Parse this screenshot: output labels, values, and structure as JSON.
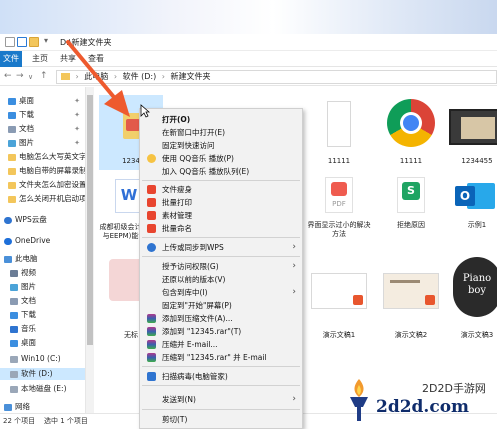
{
  "window": {
    "title_path": "D:\\新建文件夹"
  },
  "ribbon": {
    "tabs": [
      "文件",
      "主页",
      "共享",
      "查看"
    ]
  },
  "address": {
    "crumbs": [
      "此电脑",
      "软件 (D:)",
      "新建文件夹"
    ]
  },
  "sidebar": {
    "items": [
      {
        "label": "桌面",
        "pinned": true
      },
      {
        "label": "下载",
        "pinned": true
      },
      {
        "label": "文档",
        "pinned": true
      },
      {
        "label": "图片",
        "pinned": true
      },
      {
        "label": "电脑怎么大写英文字"
      },
      {
        "label": "电脑自带的屏幕录制"
      },
      {
        "label": "文件夹怎么加密设置"
      },
      {
        "label": "怎么关闭开机启动项"
      },
      {
        "label": "WPS云盘"
      },
      {
        "label": "OneDrive"
      },
      {
        "label": "此电脑"
      },
      {
        "label": "视频"
      },
      {
        "label": "图片"
      },
      {
        "label": "文档"
      },
      {
        "label": "下载"
      },
      {
        "label": "音乐"
      },
      {
        "label": "桌面"
      },
      {
        "label": "Win10 (C:)"
      },
      {
        "label": "软件 (D:)"
      },
      {
        "label": "本地磁盘 (E:)"
      },
      {
        "label": "网络"
      }
    ]
  },
  "files": [
    {
      "label": "1234"
    },
    {
      "label": "11111"
    },
    {
      "label": "11111"
    },
    {
      "label": "1234455"
    },
    {
      "label": "成都初级会计行业写与EEPM)能够感证"
    },
    {
      "label": "界面显示过小的解决方法"
    },
    {
      "label": "拒绝原因"
    },
    {
      "label": "示例1"
    },
    {
      "label": "无标"
    },
    {
      "label": "演示文稿1"
    },
    {
      "label": "演示文稿2"
    },
    {
      "label": "演示文稿3"
    }
  ],
  "status": {
    "count": "22 个项目",
    "selected": "选中 1 个项目"
  },
  "context_menu": {
    "items": [
      {
        "label": "打开(O)",
        "bold": true
      },
      {
        "label": "在新窗口中打开(E)"
      },
      {
        "label": "固定到快速访问"
      },
      {
        "label": "使用 QQ音乐 播放(P)"
      },
      {
        "label": "加入 QQ音乐 播放队列(E)"
      },
      {
        "label": "文件瘦身"
      },
      {
        "label": "批量打印"
      },
      {
        "label": "素材管理"
      },
      {
        "label": "批量命名"
      },
      {
        "label": "上传或同步到WPS",
        "submenu": true
      },
      {
        "label": "授予访问权限(G)",
        "submenu": true
      },
      {
        "label": "还原以前的版本(V)"
      },
      {
        "label": "包含到库中(I)",
        "submenu": true
      },
      {
        "label": "固定到\"开始\"屏幕(P)"
      },
      {
        "label": "添加到压缩文件(A)..."
      },
      {
        "label": "添加到 \"12345.rar\"(T)"
      },
      {
        "label": "压缩并 E-mail..."
      },
      {
        "label": "压缩到 \"12345.rar\" 并 E-mail"
      },
      {
        "label": "扫描病毒(电脑管家)"
      },
      {
        "label": "发送到(N)",
        "submenu": true
      },
      {
        "label": "剪切(T)"
      }
    ]
  },
  "watermark": {
    "brand": "2d2d.com",
    "subtitle": "2D2D手游网"
  },
  "colors": {
    "accent": "#1979ca",
    "menu_bg": "#f2f2f2",
    "selection": "#cce8ff",
    "arrow": "#ee5a2e"
  }
}
